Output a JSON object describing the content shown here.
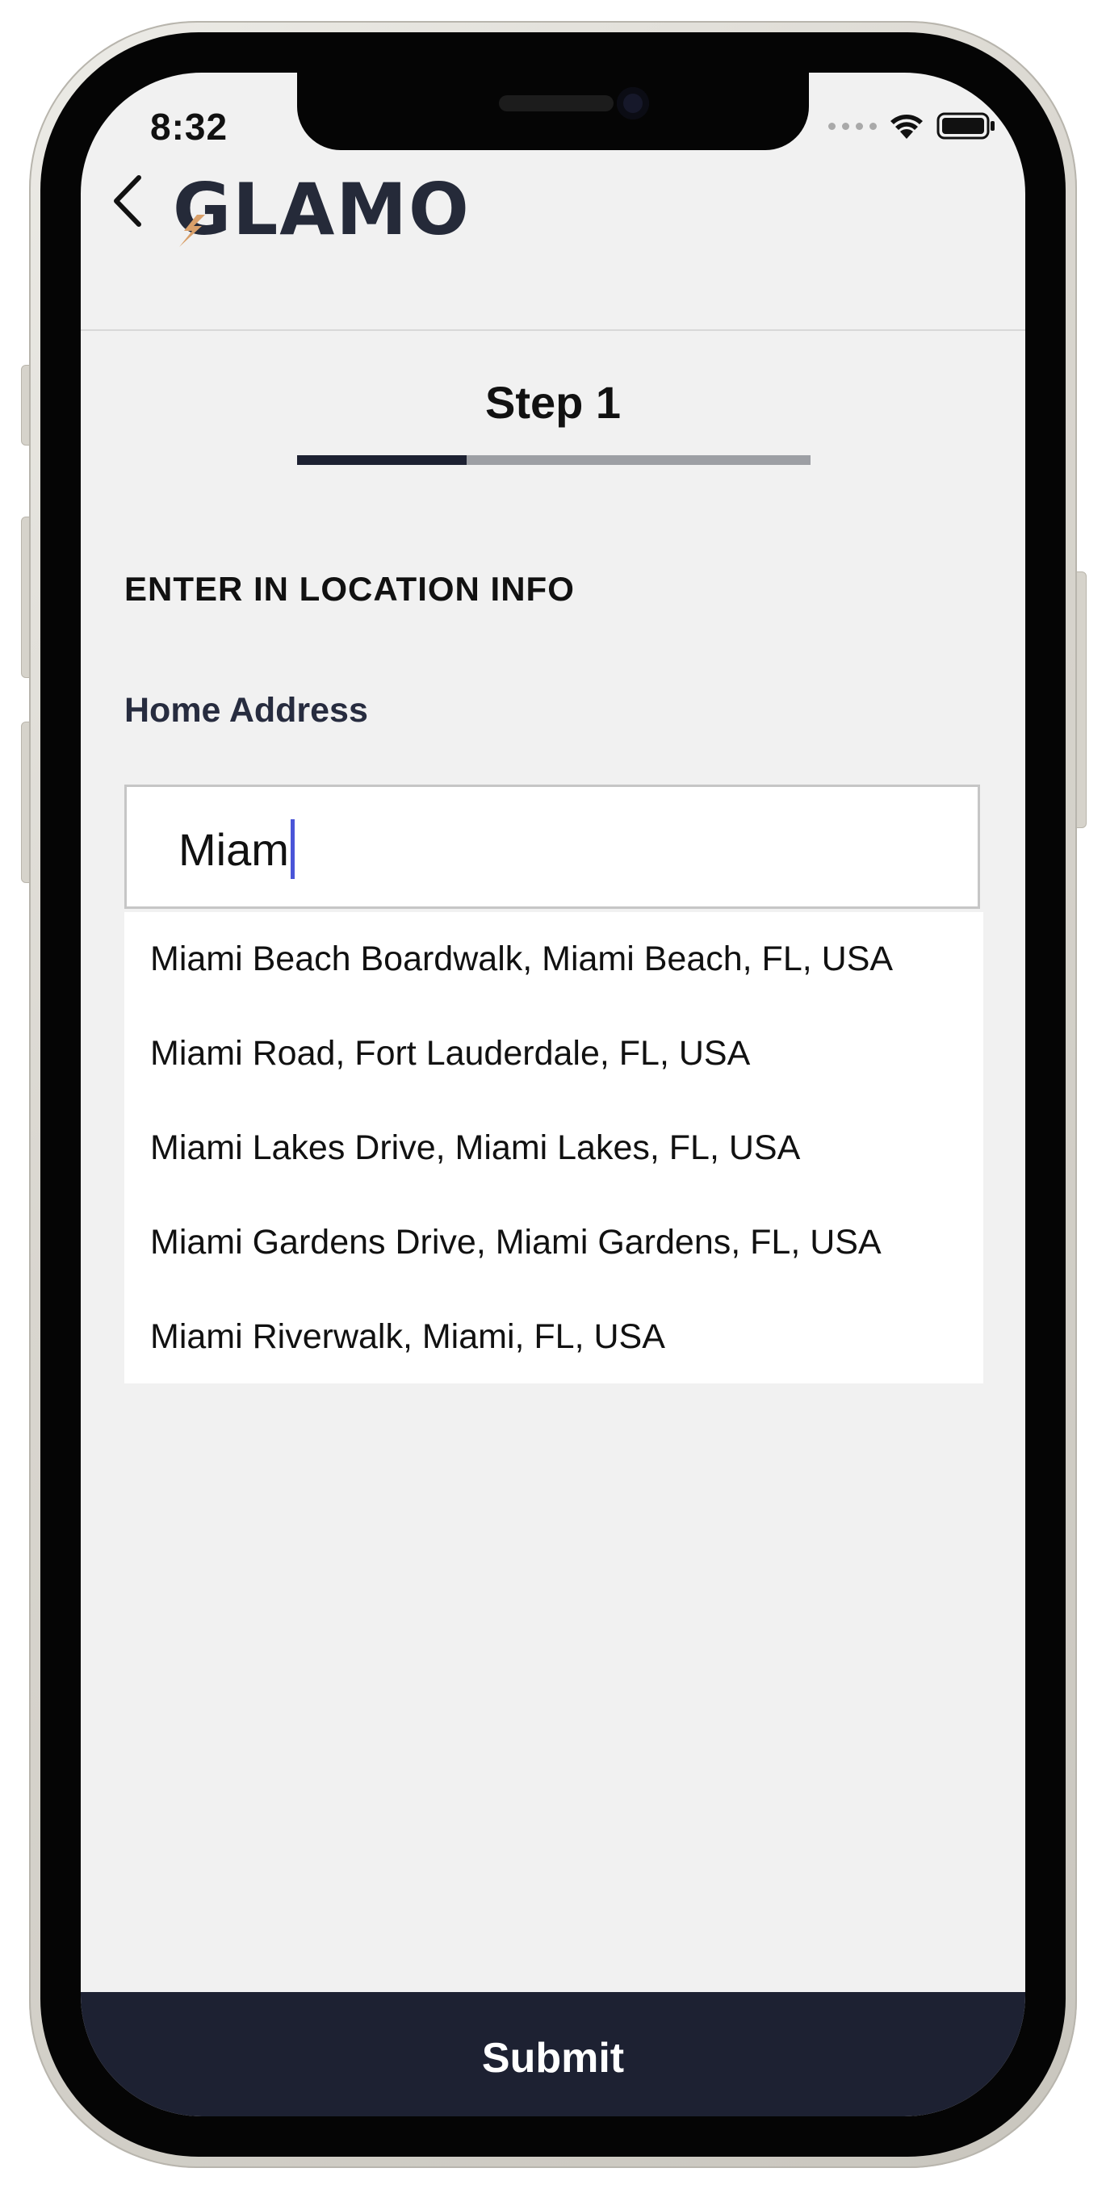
{
  "status_bar": {
    "time": "8:32"
  },
  "header": {
    "logo_text": "GLAMO"
  },
  "step": {
    "title": "Step 1",
    "progress_fraction": 0.33
  },
  "form": {
    "section_title": "ENTER IN LOCATION INFO",
    "home_address_label": "Home Address",
    "home_address_value": "Miam"
  },
  "suggestions": [
    {
      "label": "Miami Beach Boardwalk, Miami Beach, FL, USA"
    },
    {
      "label": "Miami Road, Fort Lauderdale, FL, USA"
    },
    {
      "label": "Miami Lakes Drive, Miami Lakes, FL, USA"
    },
    {
      "label": "Miami Gardens Drive, Miami Gardens, FL, USA"
    },
    {
      "label": "Miami Riverwalk, Miami, FL, USA"
    }
  ],
  "footer": {
    "submit_label": "Submit"
  },
  "colors": {
    "navy": "#1d2132",
    "accent_bolt": "#d9a06a",
    "caret": "#4a55d8",
    "progress_track": "#9d9fa4"
  },
  "icons": {
    "back": "chevron-left-icon",
    "wifi": "wifi-icon",
    "battery": "battery-icon",
    "signal": "cellular-signal-icon"
  }
}
